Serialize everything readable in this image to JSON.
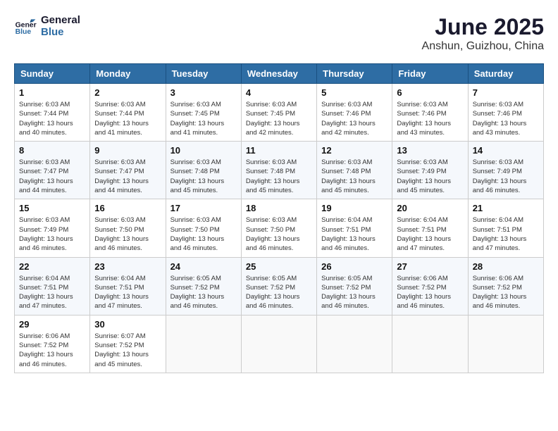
{
  "logo": {
    "line1": "General",
    "line2": "Blue"
  },
  "title": "June 2025",
  "location": "Anshun, Guizhou, China",
  "weekdays": [
    "Sunday",
    "Monday",
    "Tuesday",
    "Wednesday",
    "Thursday",
    "Friday",
    "Saturday"
  ],
  "weeks": [
    [
      {
        "day": "1",
        "info": "Sunrise: 6:03 AM\nSunset: 7:44 PM\nDaylight: 13 hours\nand 40 minutes."
      },
      {
        "day": "2",
        "info": "Sunrise: 6:03 AM\nSunset: 7:44 PM\nDaylight: 13 hours\nand 41 minutes."
      },
      {
        "day": "3",
        "info": "Sunrise: 6:03 AM\nSunset: 7:45 PM\nDaylight: 13 hours\nand 41 minutes."
      },
      {
        "day": "4",
        "info": "Sunrise: 6:03 AM\nSunset: 7:45 PM\nDaylight: 13 hours\nand 42 minutes."
      },
      {
        "day": "5",
        "info": "Sunrise: 6:03 AM\nSunset: 7:46 PM\nDaylight: 13 hours\nand 42 minutes."
      },
      {
        "day": "6",
        "info": "Sunrise: 6:03 AM\nSunset: 7:46 PM\nDaylight: 13 hours\nand 43 minutes."
      },
      {
        "day": "7",
        "info": "Sunrise: 6:03 AM\nSunset: 7:46 PM\nDaylight: 13 hours\nand 43 minutes."
      }
    ],
    [
      {
        "day": "8",
        "info": "Sunrise: 6:03 AM\nSunset: 7:47 PM\nDaylight: 13 hours\nand 44 minutes."
      },
      {
        "day": "9",
        "info": "Sunrise: 6:03 AM\nSunset: 7:47 PM\nDaylight: 13 hours\nand 44 minutes."
      },
      {
        "day": "10",
        "info": "Sunrise: 6:03 AM\nSunset: 7:48 PM\nDaylight: 13 hours\nand 45 minutes."
      },
      {
        "day": "11",
        "info": "Sunrise: 6:03 AM\nSunset: 7:48 PM\nDaylight: 13 hours\nand 45 minutes."
      },
      {
        "day": "12",
        "info": "Sunrise: 6:03 AM\nSunset: 7:48 PM\nDaylight: 13 hours\nand 45 minutes."
      },
      {
        "day": "13",
        "info": "Sunrise: 6:03 AM\nSunset: 7:49 PM\nDaylight: 13 hours\nand 45 minutes."
      },
      {
        "day": "14",
        "info": "Sunrise: 6:03 AM\nSunset: 7:49 PM\nDaylight: 13 hours\nand 46 minutes."
      }
    ],
    [
      {
        "day": "15",
        "info": "Sunrise: 6:03 AM\nSunset: 7:49 PM\nDaylight: 13 hours\nand 46 minutes."
      },
      {
        "day": "16",
        "info": "Sunrise: 6:03 AM\nSunset: 7:50 PM\nDaylight: 13 hours\nand 46 minutes."
      },
      {
        "day": "17",
        "info": "Sunrise: 6:03 AM\nSunset: 7:50 PM\nDaylight: 13 hours\nand 46 minutes."
      },
      {
        "day": "18",
        "info": "Sunrise: 6:03 AM\nSunset: 7:50 PM\nDaylight: 13 hours\nand 46 minutes."
      },
      {
        "day": "19",
        "info": "Sunrise: 6:04 AM\nSunset: 7:51 PM\nDaylight: 13 hours\nand 46 minutes."
      },
      {
        "day": "20",
        "info": "Sunrise: 6:04 AM\nSunset: 7:51 PM\nDaylight: 13 hours\nand 47 minutes."
      },
      {
        "day": "21",
        "info": "Sunrise: 6:04 AM\nSunset: 7:51 PM\nDaylight: 13 hours\nand 47 minutes."
      }
    ],
    [
      {
        "day": "22",
        "info": "Sunrise: 6:04 AM\nSunset: 7:51 PM\nDaylight: 13 hours\nand 47 minutes."
      },
      {
        "day": "23",
        "info": "Sunrise: 6:04 AM\nSunset: 7:51 PM\nDaylight: 13 hours\nand 47 minutes."
      },
      {
        "day": "24",
        "info": "Sunrise: 6:05 AM\nSunset: 7:52 PM\nDaylight: 13 hours\nand 46 minutes."
      },
      {
        "day": "25",
        "info": "Sunrise: 6:05 AM\nSunset: 7:52 PM\nDaylight: 13 hours\nand 46 minutes."
      },
      {
        "day": "26",
        "info": "Sunrise: 6:05 AM\nSunset: 7:52 PM\nDaylight: 13 hours\nand 46 minutes."
      },
      {
        "day": "27",
        "info": "Sunrise: 6:06 AM\nSunset: 7:52 PM\nDaylight: 13 hours\nand 46 minutes."
      },
      {
        "day": "28",
        "info": "Sunrise: 6:06 AM\nSunset: 7:52 PM\nDaylight: 13 hours\nand 46 minutes."
      }
    ],
    [
      {
        "day": "29",
        "info": "Sunrise: 6:06 AM\nSunset: 7:52 PM\nDaylight: 13 hours\nand 46 minutes."
      },
      {
        "day": "30",
        "info": "Sunrise: 6:07 AM\nSunset: 7:52 PM\nDaylight: 13 hours\nand 45 minutes."
      },
      null,
      null,
      null,
      null,
      null
    ]
  ]
}
